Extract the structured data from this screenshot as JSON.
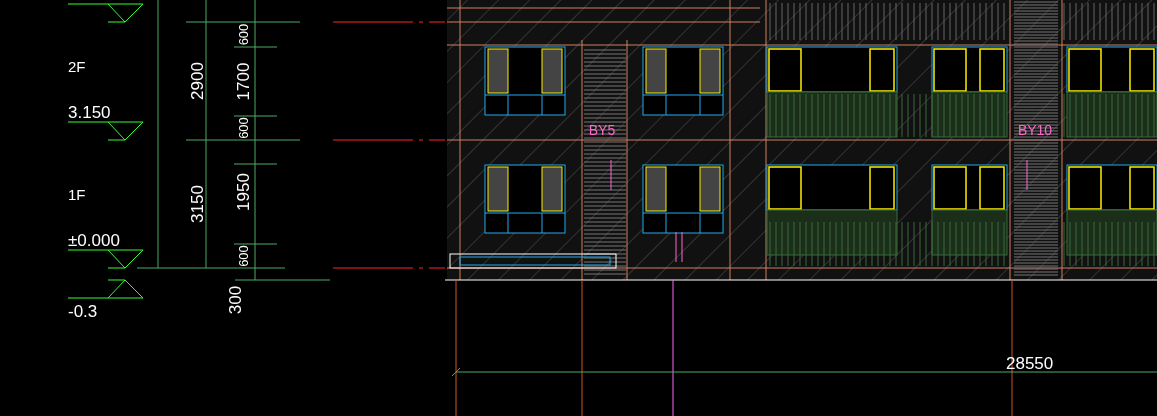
{
  "floor_labels": [
    "2F",
    "1F"
  ],
  "level_marks": [
    {
      "kind": "above",
      "value": "3.150"
    },
    {
      "kind": "above",
      "value": "±0.000"
    },
    {
      "kind": "below",
      "value": "-0.3"
    }
  ],
  "overall_dimensions": [
    "2900",
    "3150"
  ],
  "detail_dimensions": [
    "600",
    "1700",
    "600",
    "1950",
    "600"
  ],
  "below_dimension": "300",
  "tags": [
    "BY5",
    "BY10"
  ],
  "horizontal_dimension": "28550"
}
